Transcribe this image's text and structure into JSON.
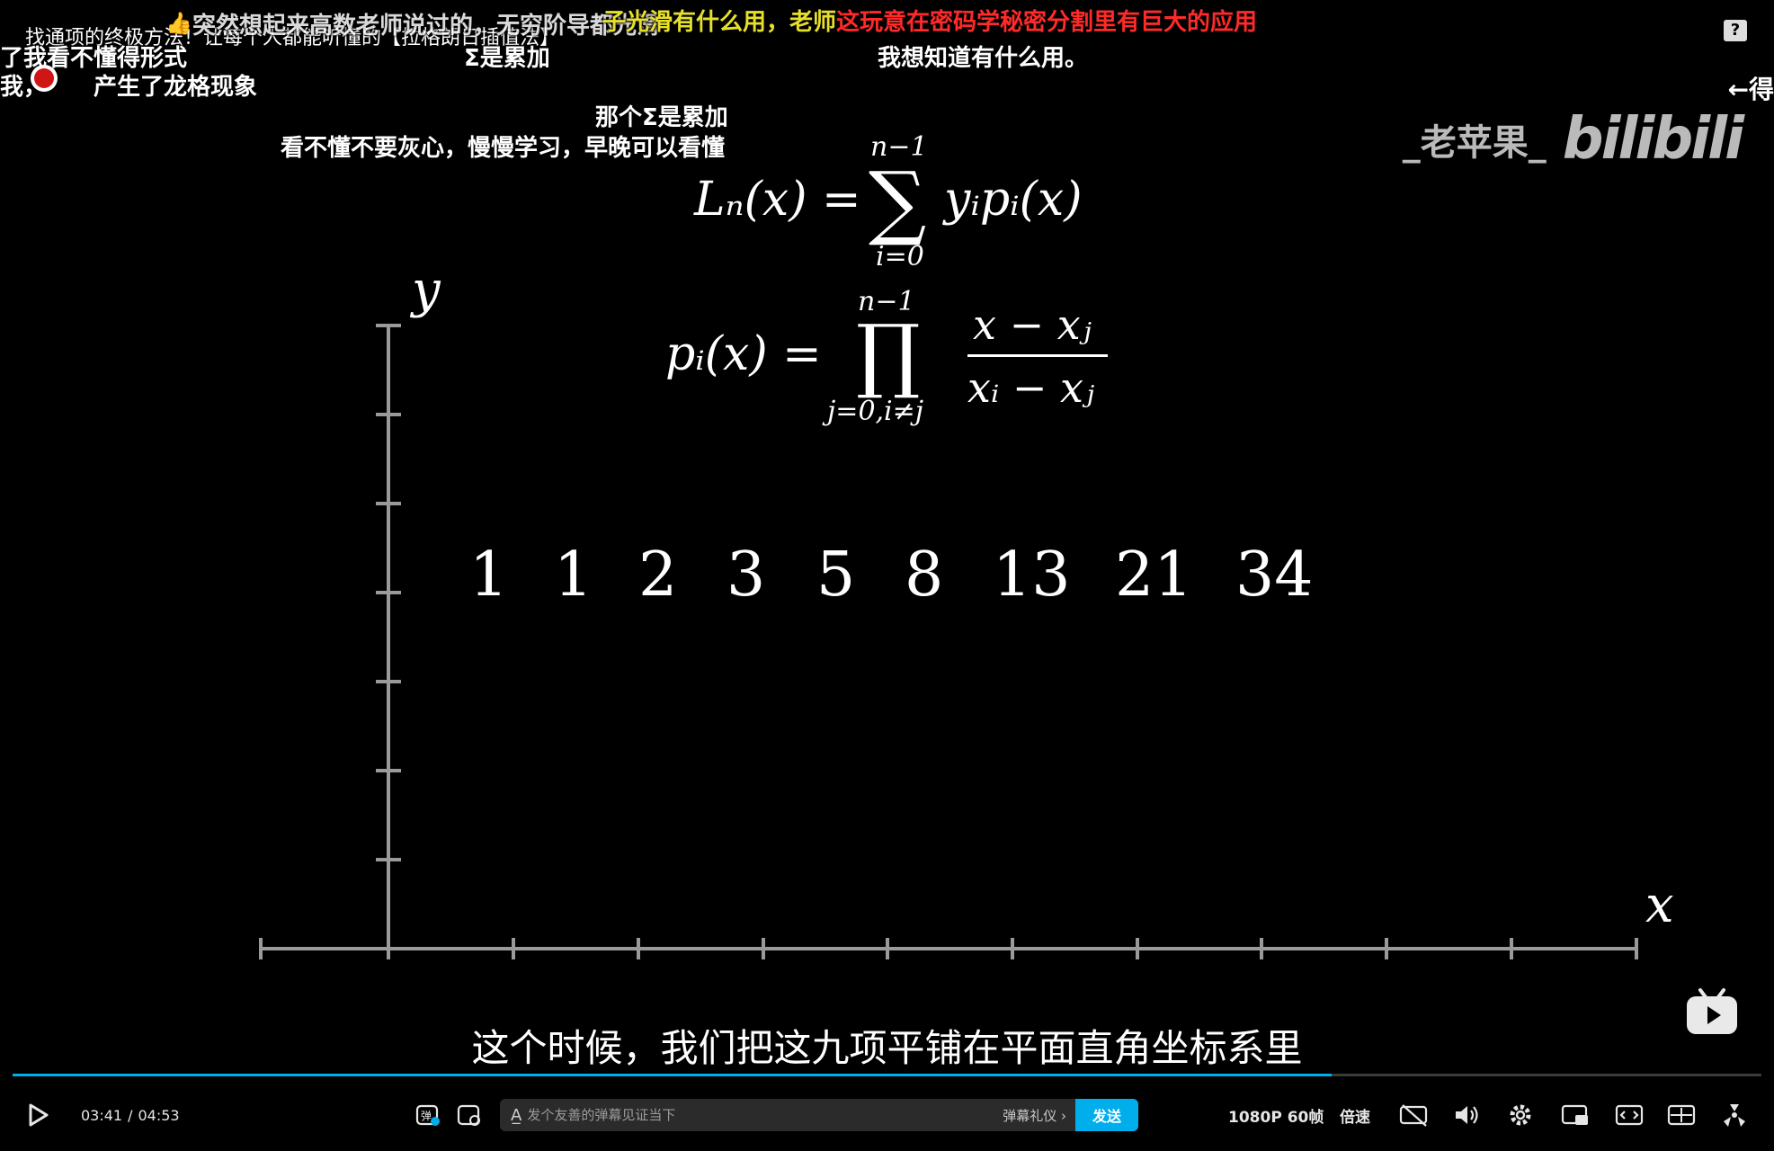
{
  "video": {
    "title_overlay": "找通项的终极方法！让每个人都能听懂的【拉格朗日插值法】",
    "danmaku": [
      {
        "text": "了我看不懂得形式",
        "color": "white"
      },
      {
        "text": "我，",
        "color": "white"
      },
      {
        "text": "产生了龙格现象",
        "color": "white"
      },
      {
        "text": "突然想起来高数老师说过的，无穷阶导都光滑",
        "color": "white"
      },
      {
        "text": "Σ是累加",
        "color": "white"
      },
      {
        "text": "子光滑有什么用，老师",
        "color": "yellow"
      },
      {
        "text": "这玩意在密码学秘密分割里有巨大的应用",
        "color": "red"
      },
      {
        "text": "我想知道有什么用。",
        "color": "white"
      },
      {
        "text": "那个Σ是累加",
        "color": "white"
      },
      {
        "text": "看不懂不要灰心，慢慢学习，早晚可以看懂",
        "color": "white"
      },
      {
        "text": "←得",
        "color": "white"
      }
    ],
    "watermark_user": "_老苹果_",
    "watermark_logo": "bilibili",
    "help_label": "?",
    "math": {
      "formula1_lhs": "Lₙ(x) =",
      "formula1_sum": "∑",
      "formula1_upper": "n−1",
      "formula1_lower": "i=0",
      "formula1_rhs": "yᵢpᵢ(x)",
      "formula2_lhs": "pᵢ(x) =",
      "formula2_prod": "∏",
      "formula2_upper": "n−1",
      "formula2_lower": "j=0,i≠j",
      "formula2_num": "x − xⱼ",
      "formula2_den": "xᵢ − xⱼ",
      "axis_y": "y",
      "axis_x": "x",
      "sequence": [
        "1",
        "1",
        "2",
        "3",
        "5",
        "8",
        "13",
        "21",
        "34"
      ]
    },
    "subtitle": "这个时候，我们把这九项平铺在平面直角坐标系里"
  },
  "player": {
    "progress": 0.7543,
    "time_current": "03:41",
    "time_separator": "/",
    "time_total": "04:53",
    "danmaku_placeholder": "发个友善的弹幕见证当下",
    "danmaku_etiquette": "弹幕礼仪 ›",
    "send_label": "发送",
    "quality_label": "1080P 60帧",
    "speed_label": "倍速",
    "accent_color": "#00aeec"
  }
}
